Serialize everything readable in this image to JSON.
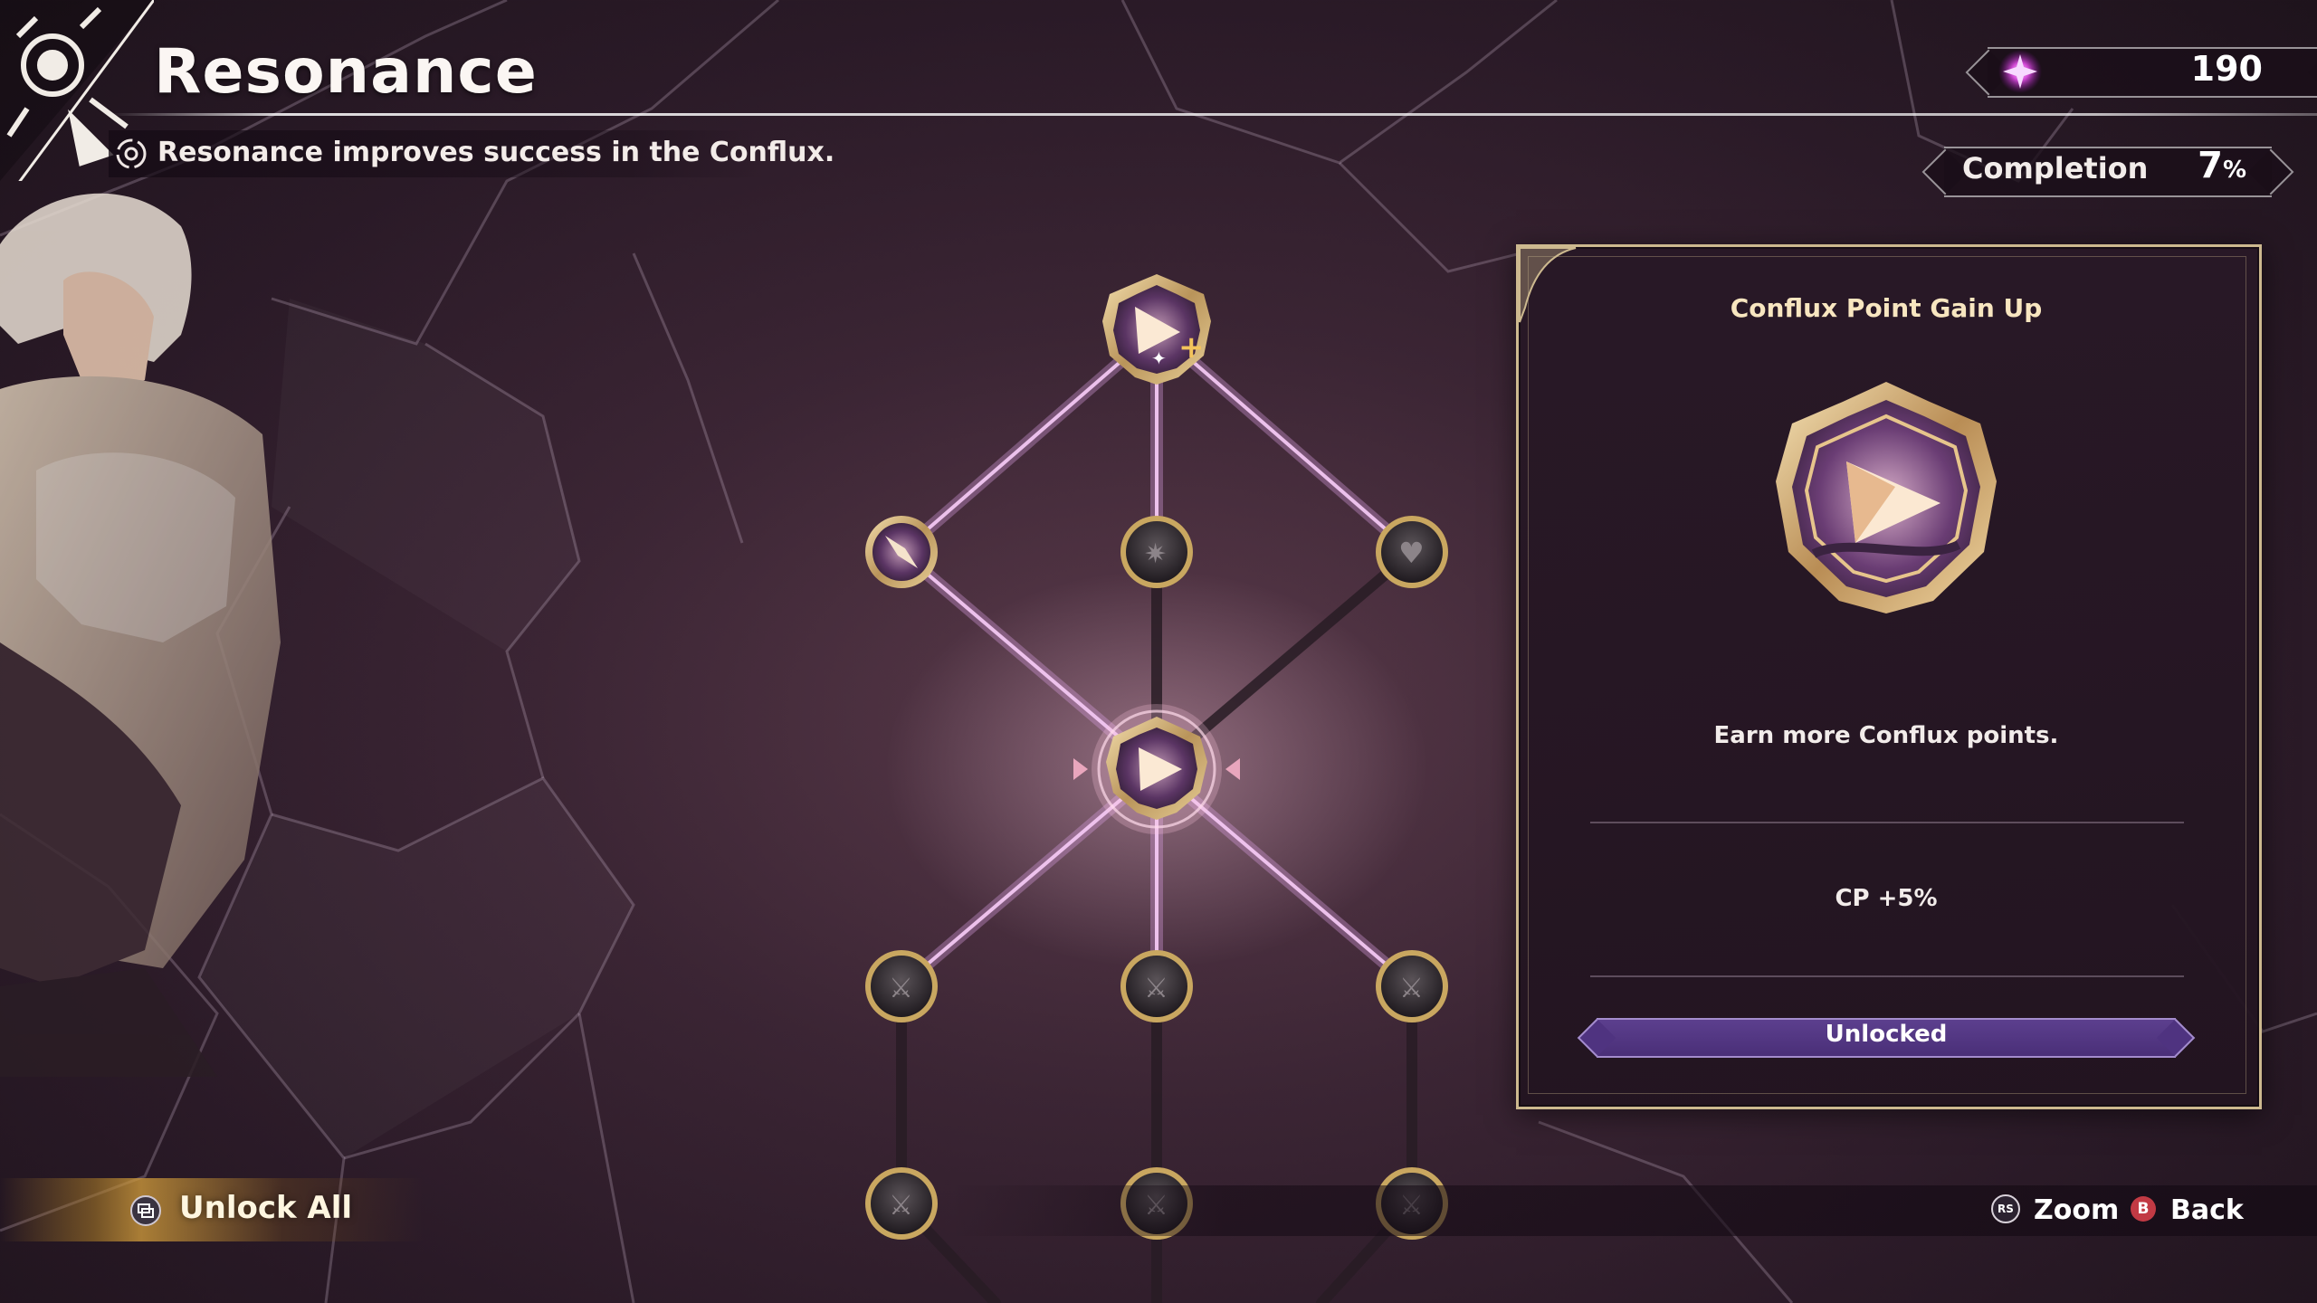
{
  "header": {
    "title": "Resonance",
    "subtitle": "Resonance improves success in the Conflux."
  },
  "status": {
    "currency_value": "190",
    "completion_label": "Completion",
    "completion_value": "7",
    "completion_unit": "%"
  },
  "tree": {
    "nodes": [
      {
        "name": "node-top",
        "state": "unlocked",
        "icon": "arrow-plus-icon"
      },
      {
        "name": "node-left",
        "state": "unlocked",
        "icon": "compass-icon"
      },
      {
        "name": "node-mid",
        "state": "locked",
        "icon": "sparkle-icon"
      },
      {
        "name": "node-right",
        "state": "locked",
        "icon": "heart-icon"
      },
      {
        "name": "node-center",
        "state": "selected",
        "icon": "arrow-icon"
      },
      {
        "name": "node-row3-left",
        "state": "locked",
        "icon": "swords-icon"
      },
      {
        "name": "node-row3-mid",
        "state": "locked",
        "icon": "swords-icon"
      },
      {
        "name": "node-row3-right",
        "state": "locked",
        "icon": "swords-icon"
      },
      {
        "name": "node-row4-left",
        "state": "locked",
        "icon": "swords-icon"
      },
      {
        "name": "node-row4-mid",
        "state": "locked",
        "icon": "swords-icon"
      },
      {
        "name": "node-row4-right",
        "state": "locked",
        "icon": "swords-icon"
      }
    ]
  },
  "detail": {
    "title": "Conflux Point Gain Up",
    "description": "Earn more Conflux points.",
    "effect": "CP +5%",
    "status_label": "Unlocked"
  },
  "footer": {
    "unlock_all_label": "Unlock All",
    "zoom_button_glyph": "RS",
    "zoom_label": "Zoom",
    "back_button_glyph": "B",
    "back_label": "Back"
  },
  "colors": {
    "accent_gold": "#cdb98f",
    "accent_purple": "#4a2f78",
    "back_red": "#c23a44"
  }
}
